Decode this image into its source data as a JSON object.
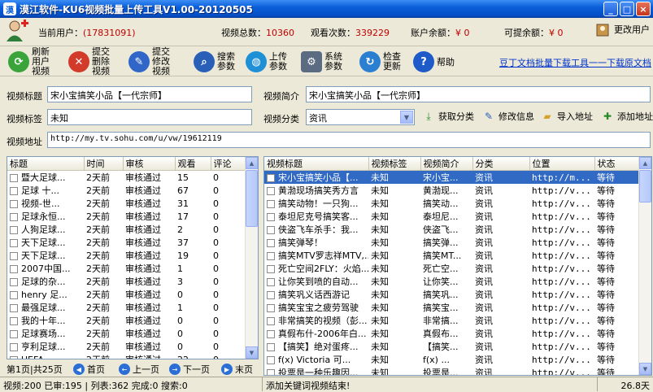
{
  "window": {
    "title": "漠江软件-KU6视频批量上传工具V1.00-20120505",
    "min": "_",
    "max": "□",
    "close": "×"
  },
  "stats": {
    "current_user_label": "当前用户：",
    "current_user_value": "(17831091)",
    "total_videos_label": "视频总数：",
    "total_videos_value": "10360",
    "views_label": "观看次数：",
    "views_value": "339229",
    "balance_label": "账户余额：",
    "balance_value": "¥ 0",
    "available_label": "可提余额：",
    "available_value": "¥ 0",
    "change_user_label": "更改用户"
  },
  "toolbar": {
    "refresh": "刷新用户视频",
    "submit_delete": "提交删除视频",
    "submit_modify": "提交修改视频",
    "search_params": "搜索参数",
    "upload_params": "上传参数",
    "system_params": "系统参数",
    "check_update": "检查更新",
    "help": "帮助",
    "top_link": "豆丁文档批量下载工具一一下载原文档"
  },
  "form": {
    "title_label": "视频标题",
    "title_value": "宋小宝搞笑小品【一代宗师】",
    "intro_label": "视频简介",
    "intro_value": "宋小宝搞笑小品【一代宗师】",
    "tag_label": "视频标签",
    "tag_value": "未知",
    "category_label": "视频分类",
    "category_value": "资讯",
    "get_category": "获取分类",
    "modify_info": "修改信息",
    "import_url": "导入地址",
    "add_url": "添加地址",
    "url_label": "视频地址",
    "url_value": "http://my.tv.sohu.com/u/vw/19612119"
  },
  "left_grid": {
    "headers": [
      "标题",
      "时间",
      "审核",
      "观看",
      "评论"
    ],
    "rows": [
      [
        "暨大足球...",
        "2天前",
        "审核通过",
        "15",
        "0"
      ],
      [
        "足球  十...",
        "2天前",
        "审核通过",
        "67",
        "0"
      ],
      [
        "视频-世...",
        "2天前",
        "审核通过",
        "31",
        "0"
      ],
      [
        "足球永恒...",
        "2天前",
        "审核通过",
        "17",
        "0"
      ],
      [
        "人狗足球...",
        "2天前",
        "审核通过",
        "2",
        "0"
      ],
      [
        "天下足球...",
        "2天前",
        "审核通过",
        "37",
        "0"
      ],
      [
        "天下足球...",
        "2天前",
        "审核通过",
        "19",
        "0"
      ],
      [
        "2007中国...",
        "2天前",
        "审核通过",
        "1",
        "0"
      ],
      [
        "足球的杂...",
        "2天前",
        "审核通过",
        "3",
        "0"
      ],
      [
        "henry 足...",
        "2天前",
        "审核通过",
        "0",
        "0"
      ],
      [
        "最强足球...",
        "2天前",
        "审核通过",
        "1",
        "0"
      ],
      [
        "我的十年...",
        "2天前",
        "审核通过",
        "0",
        "0"
      ],
      [
        "足球赛场...",
        "2天前",
        "审核通过",
        "0",
        "0"
      ],
      [
        "亨利足球...",
        "2天前",
        "审核通过",
        "0",
        "0"
      ],
      [
        "UEFA-—...",
        "2天前",
        "审核通过",
        "22",
        "0"
      ],
      [
        "爆笑足球...",
        "2天前",
        "审核通过",
        "1",
        "0"
      ]
    ]
  },
  "right_grid": {
    "headers": [
      "视频标题",
      "视频标签",
      "视频简介",
      "分类",
      "位置",
      "状态"
    ],
    "rows": [
      [
        "宋小宝搞笑小品【...",
        "未知",
        "宋小宝...",
        "资讯",
        "http://m...",
        "等待"
      ],
      [
        "黄渤现场搞笑秀方言",
        "未知",
        "黄渤现...",
        "资讯",
        "http://v...",
        "等待"
      ],
      [
        "搞笑动物！一只狗...",
        "未知",
        "搞笑动...",
        "资讯",
        "http://v...",
        "等待"
      ],
      [
        "泰坦尼克号搞笑客...",
        "未知",
        "泰坦尼...",
        "资讯",
        "http://v...",
        "等待"
      ],
      [
        "侠盗飞车杀手：我...",
        "未知",
        "侠盗飞...",
        "资讯",
        "http://v...",
        "等待"
      ],
      [
        "搞笑弹琴！",
        "未知",
        "搞笑弹...",
        "资讯",
        "http://v...",
        "等待"
      ],
      [
        "搞笑MTV罗志祥MTV,...",
        "未知",
        "搞笑MT...",
        "资讯",
        "http://v...",
        "等待"
      ],
      [
        "死亡空间2FLY：火焰...",
        "未知",
        "死亡空...",
        "资讯",
        "http://v...",
        "等待"
      ],
      [
        "让你笑到喷的自动...",
        "未知",
        "让你笑...",
        "资讯",
        "http://v...",
        "等待"
      ],
      [
        "搞笑巩义话西游记",
        "未知",
        "搞笑巩...",
        "资讯",
        "http://v...",
        "等待"
      ],
      [
        "搞笑宝宝之疲劳驾驶",
        "未知",
        "搞笑宝...",
        "资讯",
        "http://v...",
        "等待"
      ],
      [
        "非常搞笑的视频（彭...",
        "未知",
        "非常搞...",
        "资讯",
        "http://v...",
        "等待"
      ],
      [
        "真假布什-2006年白...",
        "未知",
        "真假布...",
        "资讯",
        "http://v...",
        "等待"
      ],
      [
        "【搞笑】绝对蛋疼...",
        "未知",
        "【搞笑...",
        "资讯",
        "http://v...",
        "等待"
      ],
      [
        "f(x)  Victoria 可...",
        "未知",
        "f(x) ...",
        "资讯",
        "http://v...",
        "等待"
      ],
      [
        "投票是一种乐趣因...",
        "未知",
        "投票是...",
        "资讯",
        "http://v...",
        "等待"
      ],
      [
        "百变星君CD1周星驰...",
        "未知",
        "百变星...",
        "资讯",
        "http://v...",
        "等待"
      ]
    ]
  },
  "pager": {
    "info": "第1页|共25页",
    "first": "首页",
    "prev": "上一页",
    "next": "下一页",
    "last": "末页"
  },
  "status": {
    "left": "视频:200 已审:195 | 列表:362 完成:0 搜索:0",
    "middle": "添加关键词视频结束!",
    "right": "26.8天"
  }
}
